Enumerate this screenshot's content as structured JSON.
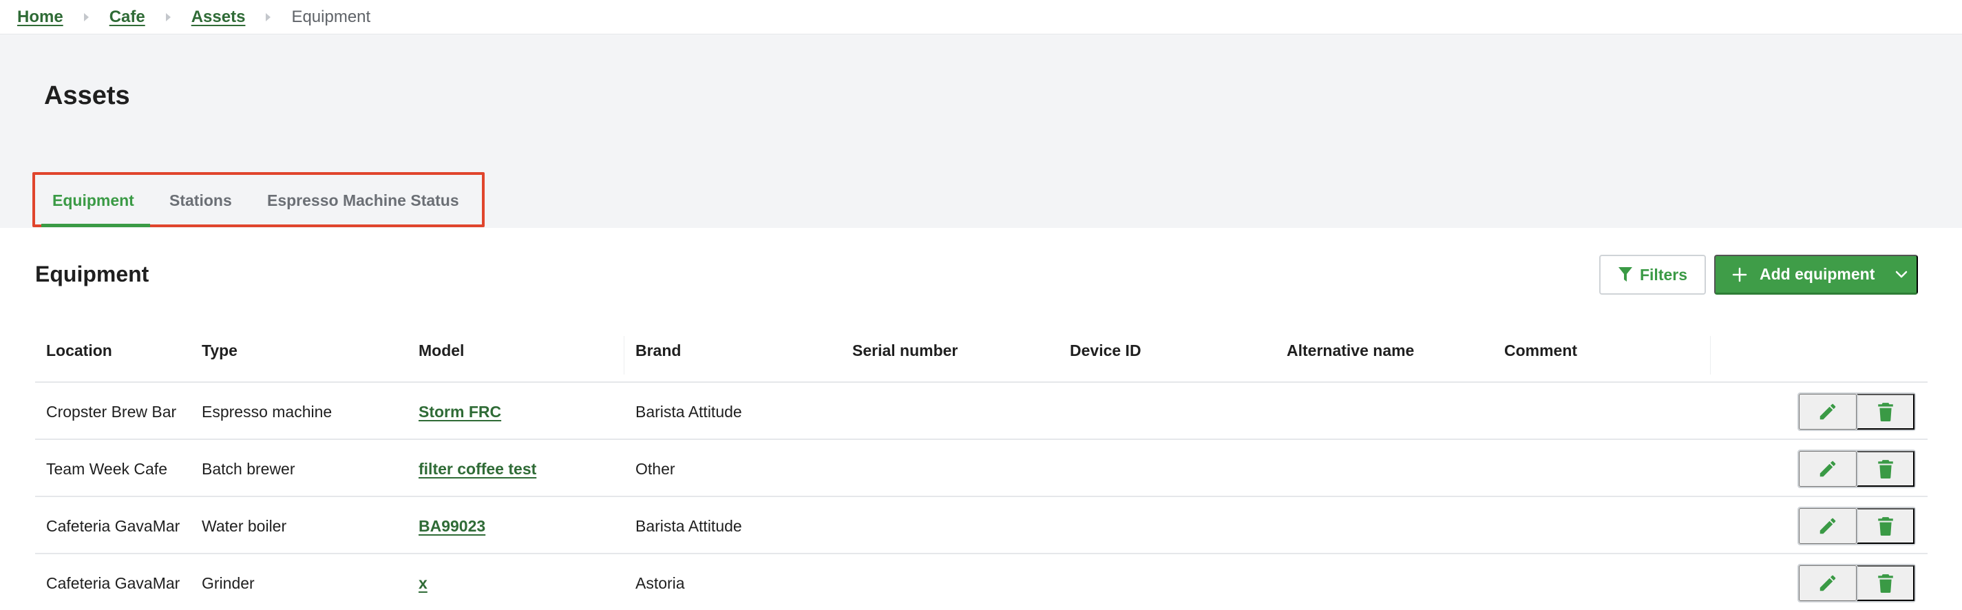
{
  "breadcrumb": {
    "items": [
      "Home",
      "Cafe",
      "Assets"
    ],
    "current": "Equipment"
  },
  "page": {
    "title": "Assets"
  },
  "tabs": [
    {
      "label": "Equipment",
      "active": true
    },
    {
      "label": "Stations",
      "active": false
    },
    {
      "label": "Espresso Machine Status",
      "active": false
    }
  ],
  "section": {
    "title": "Equipment",
    "filters_label": "Filters",
    "add_label": "Add equipment"
  },
  "table": {
    "columns": [
      "Location",
      "Type",
      "Model",
      "Brand",
      "Serial number",
      "Device ID",
      "Alternative name",
      "Comment"
    ],
    "rows": [
      {
        "location": "Cropster Brew Bar",
        "type": "Espresso machine",
        "model": "Storm FRC",
        "brand": "Barista Attitude",
        "serial": "",
        "device_id": "",
        "alt_name": "",
        "comment": ""
      },
      {
        "location": "Team Week Cafe",
        "type": "Batch brewer",
        "model": "filter coffee test",
        "brand": "Other",
        "serial": "",
        "device_id": "",
        "alt_name": "",
        "comment": ""
      },
      {
        "location": "Cafeteria GavaMar",
        "type": "Water boiler",
        "model": "BA99023",
        "brand": "Barista Attitude",
        "serial": "",
        "device_id": "",
        "alt_name": "",
        "comment": ""
      },
      {
        "location": "Cafeteria GavaMar",
        "type": "Grinder",
        "model": "x",
        "brand": "Astoria",
        "serial": "",
        "device_id": "",
        "alt_name": "",
        "comment": ""
      }
    ]
  },
  "icons": {
    "filter": "filter-icon",
    "add": "plus-icon",
    "dropdown": "chevron-down-icon",
    "edit": "pencil-icon",
    "delete": "trash-icon"
  },
  "colors": {
    "accent": "#3a9a45",
    "link": "#2f6b36",
    "highlight": "#e0452d",
    "header_bg": "#f3f4f6"
  }
}
